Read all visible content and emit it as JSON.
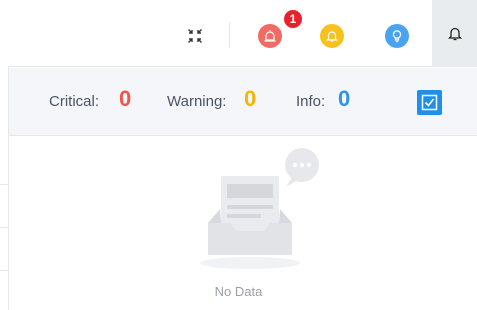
{
  "topbar": {
    "fullscreen_icon": "fullscreen-exit-icon",
    "alerts": [
      {
        "name": "critical-alerts",
        "icon": "siren-icon",
        "color": "#f26a64"
      },
      {
        "name": "warning-alerts",
        "icon": "bell-icon",
        "color": "#f8c21e"
      },
      {
        "name": "info-alerts",
        "icon": "lightbulb-icon",
        "color": "#4aa3f0"
      }
    ],
    "critical_badge": "1",
    "notification_icon": "bell-outline-icon"
  },
  "panel": {
    "critical_label": "Critical:",
    "critical_value": "0",
    "warning_label": "Warning:",
    "warning_value": "0",
    "info_label": "Info:",
    "info_value": "0",
    "mark_read_icon": "check-square-icon"
  },
  "empty": {
    "text": "No Data",
    "icon": "empty-inbox-icon"
  },
  "colors": {
    "critical": "#f0554c",
    "warning": "#f7b500",
    "info": "#2f93ee",
    "accent": "#1f8fe8"
  }
}
